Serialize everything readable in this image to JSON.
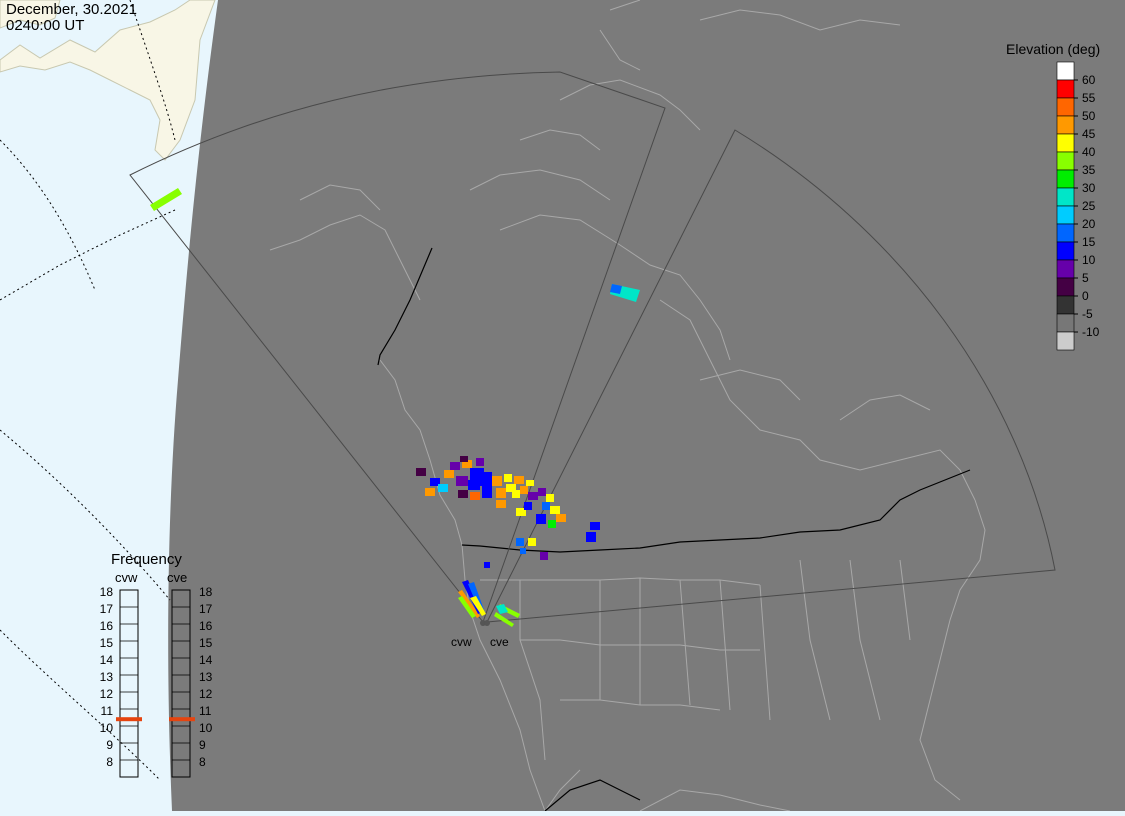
{
  "header": {
    "date": "December, 30.2021",
    "time": "0240:00 UT"
  },
  "colors": {
    "ocean": "#e8f6fd",
    "night_side": "#7b7b7b",
    "land_daylit": "#f8f6e6",
    "coastline": "#a8a8a8",
    "border": "#000000",
    "fov_outline": "#4a4a4a",
    "frequency_marker": "#e6440f"
  },
  "elevation_legend": {
    "title": "Elevation (deg)",
    "ticks": [
      "60",
      "55",
      "50",
      "45",
      "40",
      "35",
      "30",
      "25",
      "20",
      "15",
      "10",
      "5",
      "0",
      "-5",
      "-10"
    ],
    "colors": [
      "#ffffff",
      "#ff0000",
      "#ff6600",
      "#ff9900",
      "#ffff00",
      "#88ff00",
      "#00ee00",
      "#00e6c8",
      "#00ccff",
      "#0066ff",
      "#0000ff",
      "#6600aa",
      "#440044",
      "#333333",
      "#777777",
      "#cccccc"
    ]
  },
  "frequency_panel": {
    "title": "Frequency",
    "radars": [
      {
        "name": "cvw",
        "frequency_mhz": 10.9
      },
      {
        "name": "cve",
        "frequency_mhz": 10.9
      }
    ],
    "ticks": [
      "18",
      "17",
      "16",
      "15",
      "14",
      "13",
      "12",
      "11",
      "10",
      "9",
      "8"
    ]
  },
  "radar_sites": [
    {
      "code": "cvw"
    },
    {
      "code": "cve"
    }
  ]
}
